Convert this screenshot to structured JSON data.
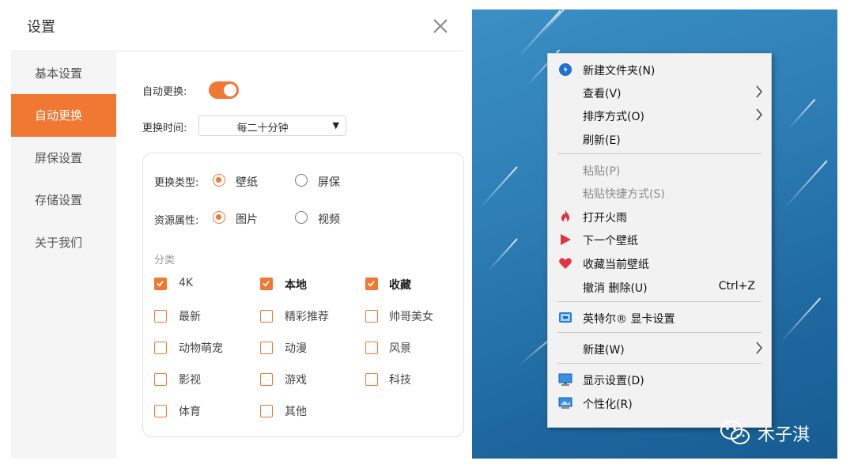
{
  "settings": {
    "title": "设置",
    "sidebar": {
      "items": [
        {
          "label": "基本设置"
        },
        {
          "label": "自动更换",
          "active": true
        },
        {
          "label": "屏保设置"
        },
        {
          "label": "存储设置"
        },
        {
          "label": "关于我们"
        }
      ]
    },
    "auto_change": {
      "label": "自动更换:",
      "enabled": true
    },
    "interval": {
      "label": "更换时间:",
      "value": "每二十分钟"
    },
    "change_type": {
      "label": "更换类型:",
      "options": [
        {
          "label": "壁纸",
          "selected": true
        },
        {
          "label": "屏保",
          "selected": false
        }
      ]
    },
    "resource": {
      "label": "资源属性:",
      "options": [
        {
          "label": "图片",
          "selected": true
        },
        {
          "label": "视频",
          "selected": false
        }
      ]
    },
    "category": {
      "label": "分类",
      "items": [
        {
          "label": "4K",
          "checked": true
        },
        {
          "label": "本地",
          "checked": true
        },
        {
          "label": "收藏",
          "checked": true
        },
        {
          "label": "最新",
          "checked": false
        },
        {
          "label": "精彩推荐",
          "checked": false
        },
        {
          "label": "帅哥美女",
          "checked": false
        },
        {
          "label": "动物萌宠",
          "checked": false
        },
        {
          "label": "动漫",
          "checked": false
        },
        {
          "label": "风景",
          "checked": false
        },
        {
          "label": "影视",
          "checked": false
        },
        {
          "label": "游戏",
          "checked": false
        },
        {
          "label": "科技",
          "checked": false
        },
        {
          "label": "体育",
          "checked": false
        },
        {
          "label": "其他",
          "checked": false
        }
      ]
    },
    "accent_color": "#f07832"
  },
  "context_menu": {
    "items": [
      {
        "label": "新建文件夹(N)",
        "icon": "new-folder-icon"
      },
      {
        "label": "查看(V)",
        "submenu": true
      },
      {
        "label": "排序方式(O)",
        "submenu": true
      },
      {
        "label": "刷新(E)"
      },
      {
        "label": "粘贴(P)",
        "disabled": true
      },
      {
        "label": "粘贴快捷方式(S)",
        "disabled": true
      },
      {
        "label": "打开火雨",
        "icon": "fire-icon"
      },
      {
        "label": "下一个壁纸",
        "icon": "play-icon"
      },
      {
        "label": "收藏当前壁纸",
        "icon": "heart-icon"
      },
      {
        "label": "撤消 删除(U)",
        "shortcut": "Ctrl+Z"
      },
      {
        "label": "英特尔® 显卡设置",
        "icon": "intel-graphics-icon"
      },
      {
        "label": "新建(W)",
        "submenu": true
      },
      {
        "label": "显示设置(D)",
        "icon": "display-icon"
      },
      {
        "label": "个性化(R)",
        "icon": "personalize-icon"
      }
    ]
  },
  "watermark": {
    "text": "木子淇",
    "icon": "wechat-icon"
  }
}
